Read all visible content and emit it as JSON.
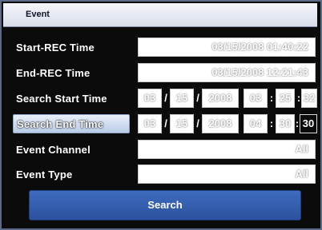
{
  "window": {
    "title": "Event"
  },
  "rows": {
    "start_rec": {
      "label": "Start-REC Time",
      "value": "03/15/2008 01:40:22"
    },
    "end_rec": {
      "label": "End-REC Time",
      "value": "03/15/2008 12:21:43"
    },
    "search_start": {
      "label": "Search Start Time",
      "month": "03",
      "day": "15",
      "year": "2008",
      "hour": "03",
      "minute": "25",
      "second": "32",
      "date_sep": "/",
      "time_sep": ":"
    },
    "search_end": {
      "label": "Search End Time",
      "month": "03",
      "day": "15",
      "year": "2008",
      "hour": "04",
      "minute": "30",
      "second": "30",
      "date_sep": "/",
      "time_sep": ":"
    },
    "event_channel": {
      "label": "Event Channel",
      "value": "All"
    },
    "event_type": {
      "label": "Event Type",
      "value": "All"
    }
  },
  "buttons": {
    "search_label": "Search"
  }
}
